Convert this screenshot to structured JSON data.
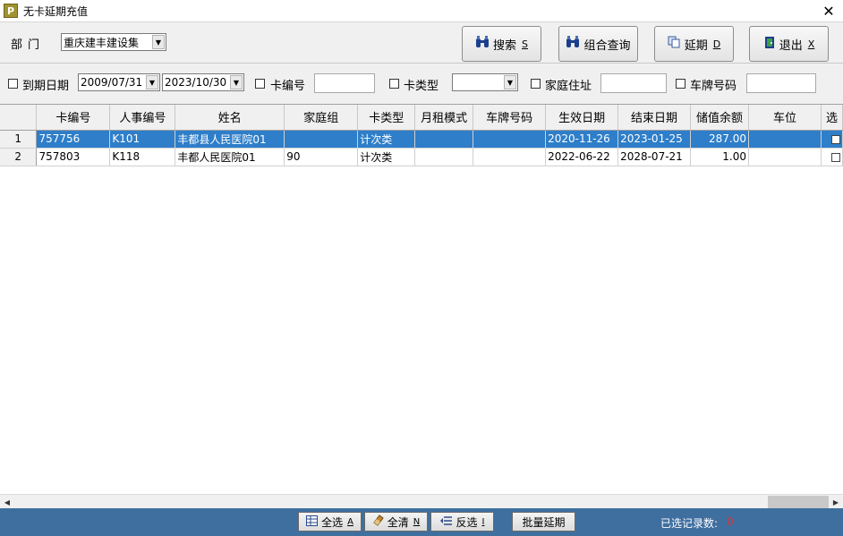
{
  "window": {
    "title": "无卡延期充值",
    "close": "✕"
  },
  "filters": {
    "dept_label": "部门",
    "dept_value": "重庆建丰建设集",
    "expire_label": "到期日期",
    "date_from": "2009/07/31",
    "date_to": "2023/10/30",
    "card_no_label": "卡编号",
    "card_type_label": "卡类型",
    "address_label": "家庭住址",
    "plate_label": "车牌号码"
  },
  "toolbar": {
    "search": {
      "label": "搜索",
      "hotkey": "S"
    },
    "combo": {
      "label": "组合查询"
    },
    "extend": {
      "label": "延期",
      "hotkey": "D"
    },
    "exit": {
      "label": "退出",
      "hotkey": "X"
    }
  },
  "table": {
    "columns": [
      "卡编号",
      "人事编号",
      "姓名",
      "家庭组",
      "卡类型",
      "月租模式",
      "车牌号码",
      "生效日期",
      "结束日期",
      "储值余额",
      "车位",
      "选"
    ],
    "rows": [
      {
        "num": "1",
        "card_no": "757756",
        "staff_no": "K101",
        "name": "丰都县人民医院01",
        "family": "",
        "type": "计次类",
        "rent": "",
        "plate": "",
        "start": "2020-11-26",
        "end": "2023-01-25",
        "balance": "287.00",
        "slot": ""
      },
      {
        "num": "2",
        "card_no": "757803",
        "staff_no": "K118",
        "name": "丰都人民医院01",
        "family": "90",
        "type": "计次类",
        "rent": "",
        "plate": "",
        "start": "2022-06-22",
        "end": "2028-07-21",
        "balance": "1.00",
        "slot": ""
      }
    ]
  },
  "bottom": {
    "select_all": {
      "label": "全选",
      "hotkey": "A"
    },
    "clear_all": {
      "label": "全清",
      "hotkey": "N"
    },
    "invert": {
      "label": "反选",
      "hotkey": "I"
    },
    "batch_extend": {
      "label": "批量延期"
    },
    "selected_label": "已选记录数:",
    "selected_count": "0"
  },
  "icons": {
    "app": "app-p-icon",
    "search": "binoculars-icon",
    "combo": "binoculars-icon",
    "extend": "copy-icon",
    "exit": "door-exit-icon",
    "select_all": "grid-check-icon",
    "clear_all": "eraser-icon",
    "invert": "invert-list-icon"
  },
  "colors": {
    "selected_row": "#2e7ec9",
    "status_bar": "#3f6f9f",
    "count": "#e03030"
  }
}
